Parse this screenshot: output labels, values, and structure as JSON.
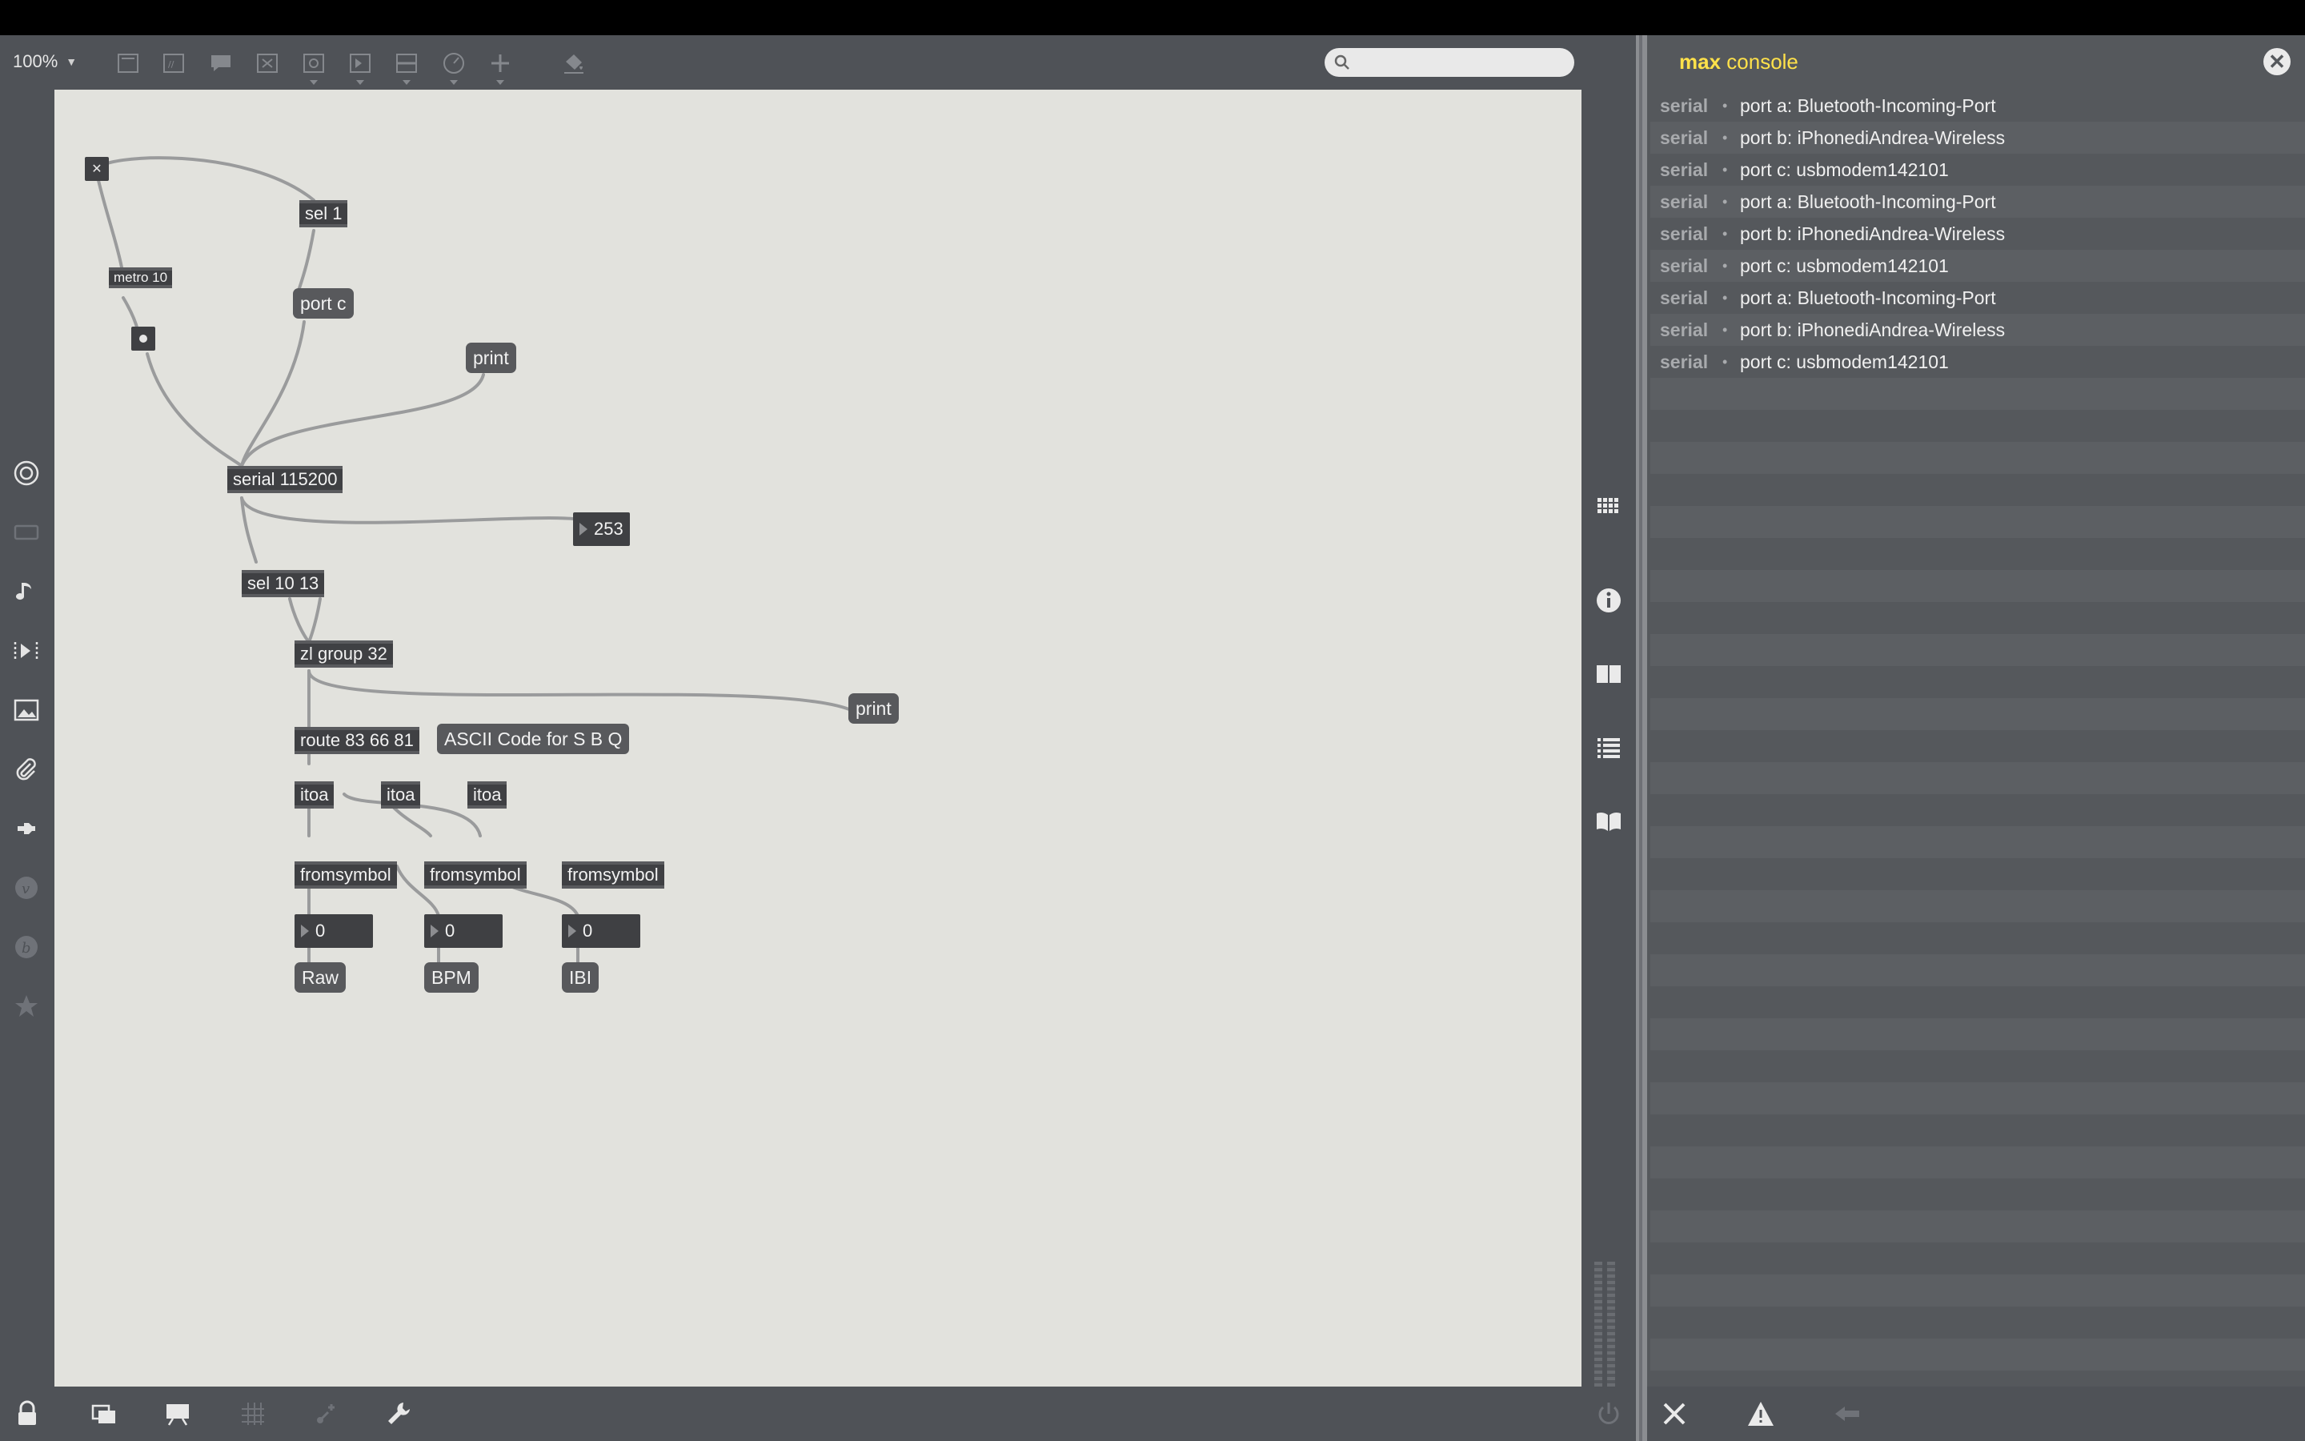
{
  "toolbar": {
    "zoom_label": "100%"
  },
  "search": {
    "placeholder": ""
  },
  "patch": {
    "toggle_glyph": "✕",
    "sel1": "sel 1",
    "metro": "metro 10",
    "port_c": "port c",
    "print1": "print",
    "serial": "serial 115200",
    "num_253": "253",
    "sel_10_13": "sel 10 13",
    "zl_group": "zl group 32",
    "print2": "print",
    "route": "route 83 66 81",
    "comment": "ASCII Code for S B Q",
    "itoa_1": "itoa",
    "itoa_2": "itoa",
    "itoa_3": "itoa",
    "fromsymbol_1": "fromsymbol",
    "fromsymbol_2": "fromsymbol",
    "fromsymbol_3": "fromsymbol",
    "num_1": "0",
    "num_2": "0",
    "num_3": "0",
    "msg_raw": "Raw",
    "msg_bpm": "BPM",
    "msg_ibi": "IBI"
  },
  "console": {
    "title_bold": "max",
    "title_rest": " console",
    "close_glyph": "✕",
    "rows": [
      {
        "source": "serial",
        "bullet": "•",
        "text": "port a: Bluetooth-Incoming-Port"
      },
      {
        "source": "serial",
        "bullet": "•",
        "text": "port b: iPhonediAndrea-Wireless"
      },
      {
        "source": "serial",
        "bullet": "•",
        "text": "port c: usbmodem142101"
      },
      {
        "source": "serial",
        "bullet": "•",
        "text": "port a: Bluetooth-Incoming-Port"
      },
      {
        "source": "serial",
        "bullet": "•",
        "text": "port b: iPhonediAndrea-Wireless"
      },
      {
        "source": "serial",
        "bullet": "•",
        "text": "port c: usbmodem142101"
      },
      {
        "source": "serial",
        "bullet": "•",
        "text": "port a: Bluetooth-Incoming-Port"
      },
      {
        "source": "serial",
        "bullet": "•",
        "text": "port b: iPhonediAndrea-Wireless"
      },
      {
        "source": "serial",
        "bullet": "•",
        "text": "port c: usbmodem142101"
      }
    ]
  },
  "colors": {
    "canvas": "#e2e2dd",
    "object": "#3f4043",
    "console_accent": "#ffe14a"
  }
}
